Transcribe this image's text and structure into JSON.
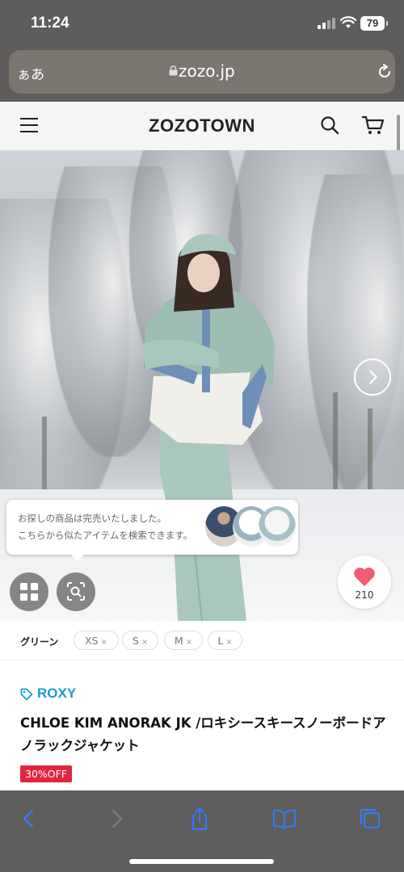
{
  "status_bar": {
    "time": "11:24",
    "battery": "79",
    "icons": [
      "signal-icon",
      "wifi-icon",
      "battery-icon"
    ]
  },
  "url_bar": {
    "text_size_label": "ぁあ",
    "domain": "zozo.jp",
    "icons": [
      "lock-icon",
      "reload-icon"
    ]
  },
  "header": {
    "logo": "ZOZOTOWN",
    "icons": [
      "menu-icon",
      "search-icon",
      "cart-icon"
    ]
  },
  "hero": {
    "sold_out_line1": "お探しの商品は完売いたしました。",
    "sold_out_line2": "こちらから似たアイテムを検索できます。",
    "favorite_count": "210",
    "icons": [
      "next-arrow-icon",
      "grid-icon",
      "image-search-icon",
      "heart-icon"
    ]
  },
  "sizes": {
    "color_label": "グリーン",
    "options": [
      {
        "label": "XS",
        "remove": "×"
      },
      {
        "label": "S",
        "remove": "×"
      },
      {
        "label": "M",
        "remove": "×"
      },
      {
        "label": "L",
        "remove": "×"
      }
    ]
  },
  "product": {
    "brand": "ROXY",
    "title": "CHLOE KIM ANORAK JK /ロキシースキースノーボードアノラックジャケット",
    "discount": "30%OFF"
  },
  "colors": {
    "accent_blue": "#1a9ad1",
    "discount_red": "#e0263f",
    "heart_pink": "#ef5d72",
    "toolbar_icon_blue": "#2f7df6"
  },
  "toolbar": {
    "icons": [
      "back-icon",
      "forward-icon",
      "share-icon",
      "bookmarks-icon",
      "tabs-icon"
    ]
  }
}
